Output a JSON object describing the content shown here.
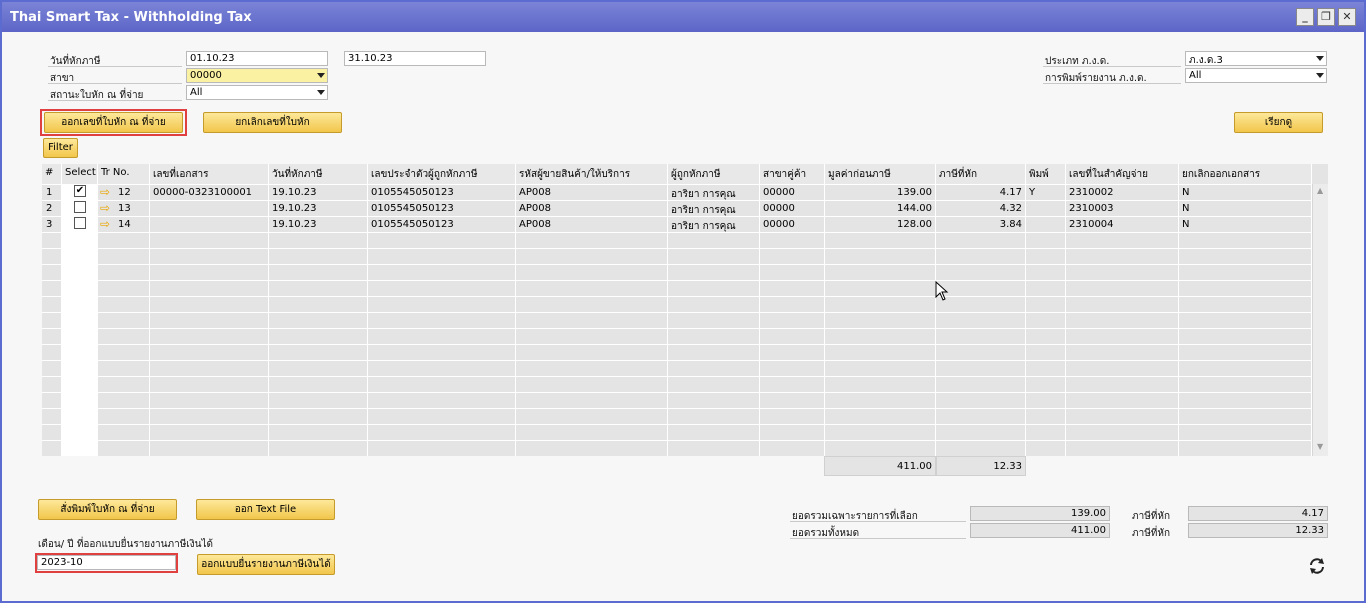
{
  "window": {
    "title": "Thai Smart Tax - Withholding Tax",
    "min_icon": "minimize-icon",
    "restore_icon": "restore-icon",
    "close_icon": "close-icon"
  },
  "filters": {
    "tax_date_label": "วันที่หักภาษี",
    "date_from": "01.10.23",
    "date_to": "31.10.23",
    "branch_label": "สาขา",
    "branch_value": "00000",
    "place_label": "สถานะใบหัก ณ ที่จ่าย",
    "place_value": "All",
    "pnd_type_label": "ประเภท ภ.ง.ด.",
    "pnd_type_value": "ภ.ง.ด.3",
    "pnd_print_label": "การพิมพ์รายงาน ภ.ง.ด.",
    "pnd_print_value": "All"
  },
  "buttons": {
    "issue_cert": "ออกเลขที่ใบหัก ณ ที่จ่าย",
    "cancel_cert": "ยกเลิกเลขที่ใบหัก",
    "refresh": "เรียกดู",
    "filter": "Filter",
    "print_cert": "สั่งพิมพ์ใบหัก ณ ที่จ่าย",
    "export_text": "ออก Text File",
    "issue_form": "ออกแบบยื่นรายงานภาษีเงินได้"
  },
  "grid": {
    "headers": [
      "#",
      "Select",
      "Tr No.",
      "เลขที่เอกสาร",
      "วันที่หักภาษี",
      "เลขประจำตัวผู้ถูกหักภาษี",
      "รหัสผู้ขายสินค้า/ให้บริการ",
      "ผู้ถูกหักภาษี",
      "สาขาคู่ค้า",
      "มูลค่าก่อนภาษี",
      "ภาษีที่หัก",
      "พิมพ์",
      "เลขที่ในสำคัญจ่าย",
      "ยกเลิกออกเอกสาร"
    ],
    "rows": [
      {
        "num": "1",
        "checked": "✔",
        "tr": "12",
        "doc": "00000-0323100001",
        "date": "19.10.23",
        "taxid": "0105545050123",
        "vendor": "AP008",
        "name": "อาริยา การคุณ",
        "branch": "00000",
        "base": "139.00",
        "tax": "4.17",
        "printed": "Y",
        "voucher": "2310002",
        "cancel": "N"
      },
      {
        "num": "2",
        "checked": "",
        "tr": "13",
        "doc": "",
        "date": "19.10.23",
        "taxid": "0105545050123",
        "vendor": "AP008",
        "name": "อาริยา การคุณ",
        "branch": "00000",
        "base": "144.00",
        "tax": "4.32",
        "printed": "",
        "voucher": "2310003",
        "cancel": "N"
      },
      {
        "num": "3",
        "checked": "",
        "tr": "14",
        "doc": "",
        "date": "19.10.23",
        "taxid": "0105545050123",
        "vendor": "AP008",
        "name": "อาริยา การคุณ",
        "branch": "00000",
        "base": "128.00",
        "tax": "3.84",
        "printed": "",
        "voucher": "2310004",
        "cancel": "N"
      }
    ],
    "total_base": "411.00",
    "total_tax": "12.33"
  },
  "summary": {
    "selected_label": "ยอดรวมเฉพาะรายการที่เลือก",
    "selected_value": "139.00",
    "selected_tax_label": "ภาษีที่หัก",
    "selected_tax_value": "4.17",
    "all_label": "ยอดรวมทั้งหมด",
    "all_value": "411.00",
    "all_tax_label": "ภาษีที่หัก",
    "all_tax_value": "12.33"
  },
  "period": {
    "label": "เดือน/ ปี ที่ออกแบบยื่นรายงานภาษีเงินได้",
    "value": "2023-10"
  },
  "icons": {
    "refresh": "refresh-icon",
    "row_link": "arrow-right-icon",
    "cursor": "mouse-cursor-icon"
  },
  "colors": {
    "title_bar": "#6a73cf",
    "button_gold": "#f5cd55",
    "field_yellow": "#fbf1a3",
    "highlight_red": "#e04040"
  }
}
